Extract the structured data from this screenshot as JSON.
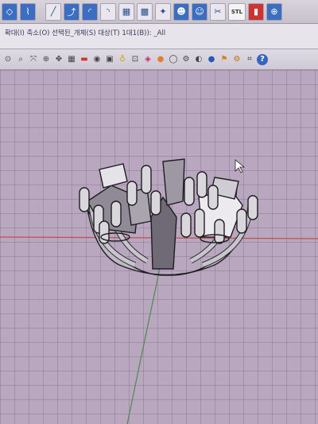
{
  "toolbar_top": {
    "buttons": [
      {
        "name": "mesh-tool-icon",
        "glyph": "◇"
      },
      {
        "name": "pipe-tool-icon",
        "glyph": "⌇"
      },
      {
        "name": "polyline-tool-icon",
        "glyph": "╱"
      },
      {
        "name": "sweep-tool-icon",
        "glyph": "⤴"
      },
      {
        "name": "arc-tool-icon",
        "glyph": "◜"
      },
      {
        "name": "revolve-tool-icon",
        "glyph": "◝"
      },
      {
        "name": "surface-tool-icon",
        "glyph": "▦"
      },
      {
        "name": "grid-array-icon",
        "glyph": "▩"
      },
      {
        "name": "points-icon",
        "glyph": "✦"
      },
      {
        "name": "users-icon",
        "glyph": "☻"
      },
      {
        "name": "people-icon",
        "glyph": "☺"
      },
      {
        "name": "tools-icon",
        "glyph": "✂"
      },
      {
        "name": "globe-icon",
        "glyph": "⊕"
      }
    ],
    "stl_label": "STL"
  },
  "command_line": {
    "text": "확대(I) 축소(O) 선택된_개체(S) 대상(T) 1대1(B)): _All"
  },
  "toolbar_2": {
    "icons": [
      {
        "name": "zoom-extents-icon",
        "glyph": "⊙"
      },
      {
        "name": "zoom-window-icon",
        "glyph": "⌕"
      },
      {
        "name": "zoom-selected-icon",
        "glyph": "⤧"
      },
      {
        "name": "zoom-icon",
        "glyph": "⊕"
      },
      {
        "name": "pan-icon",
        "glyph": "✥"
      },
      {
        "name": "four-views-icon",
        "glyph": "▦"
      },
      {
        "name": "car-icon",
        "glyph": "🚗"
      },
      {
        "name": "eye-icon",
        "glyph": "◉"
      },
      {
        "name": "camera-icon",
        "glyph": "▣"
      },
      {
        "name": "light-bulb-icon",
        "glyph": "♁"
      },
      {
        "name": "lock-icon",
        "glyph": "⊡"
      },
      {
        "name": "layers-icon",
        "glyph": "◈"
      },
      {
        "name": "color-wheel-icon",
        "glyph": "●"
      },
      {
        "name": "sphere-icon",
        "glyph": "◯"
      },
      {
        "name": "render-settings-icon",
        "glyph": "⚙"
      },
      {
        "name": "render-preview-icon",
        "glyph": "◐"
      },
      {
        "name": "globe-blue-icon",
        "glyph": "●"
      },
      {
        "name": "flag-icon",
        "glyph": "⚑"
      },
      {
        "name": "gear-icon",
        "glyph": "⚙"
      },
      {
        "name": "properties-icon",
        "glyph": "⌗"
      },
      {
        "name": "help-icon",
        "glyph": "?"
      }
    ]
  },
  "colors": {
    "viewport_bg": "#b9a7c0",
    "grid_line": "#8a7594",
    "x_axis": "#c0504d",
    "y_axis": "#4e8a4e",
    "model_fill": "#d9d6dc",
    "model_edge": "#1e1e22"
  }
}
